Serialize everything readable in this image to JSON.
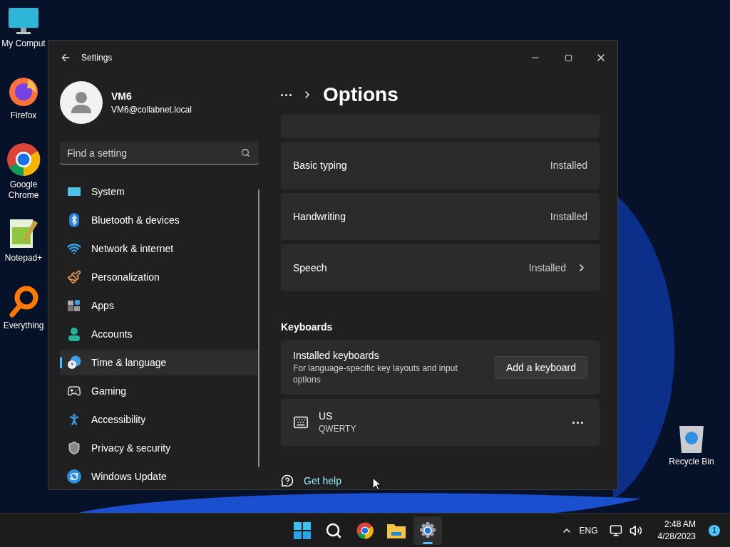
{
  "desktop": {
    "icons": [
      {
        "label": "My Comput",
        "kind": "computer"
      },
      {
        "label": "Firefox",
        "kind": "firefox"
      },
      {
        "label": "Google Chrome",
        "kind": "chrome"
      },
      {
        "label": "Notepad+",
        "kind": "notepad"
      },
      {
        "label": "Everything",
        "kind": "search"
      },
      {
        "label": "Recycle Bin",
        "kind": "recycle"
      }
    ]
  },
  "window": {
    "title": "Settings",
    "profile": {
      "name": "VM6",
      "email": "VM6@collabnet.local"
    },
    "search": {
      "placeholder": "Find a setting"
    },
    "nav": [
      {
        "label": "System",
        "kind": "system",
        "selected": false
      },
      {
        "label": "Bluetooth & devices",
        "kind": "bluetooth",
        "selected": false
      },
      {
        "label": "Network & internet",
        "kind": "network",
        "selected": false
      },
      {
        "label": "Personalization",
        "kind": "personalization",
        "selected": false
      },
      {
        "label": "Apps",
        "kind": "apps",
        "selected": false
      },
      {
        "label": "Accounts",
        "kind": "accounts",
        "selected": false
      },
      {
        "label": "Time & language",
        "kind": "time",
        "selected": true
      },
      {
        "label": "Gaming",
        "kind": "gaming",
        "selected": false
      },
      {
        "label": "Accessibility",
        "kind": "accessibility",
        "selected": false
      },
      {
        "label": "Privacy & security",
        "kind": "privacy",
        "selected": false
      },
      {
        "label": "Windows Update",
        "kind": "update",
        "selected": false
      }
    ],
    "page_title": "Options",
    "features": [
      {
        "label": "Basic typing",
        "status": "Installed",
        "expandable": false
      },
      {
        "label": "Handwriting",
        "status": "Installed",
        "expandable": false
      },
      {
        "label": "Speech",
        "status": "Installed",
        "expandable": true
      }
    ],
    "keyboards": {
      "heading": "Keyboards",
      "title": "Installed keyboards",
      "description": "For language-specific key layouts and input options",
      "button": "Add a keyboard",
      "layouts": [
        {
          "name": "US",
          "variant": "QWERTY"
        }
      ]
    },
    "help_link": "Get help"
  },
  "taskbar": {
    "apps": [
      {
        "kind": "start",
        "selected": false
      },
      {
        "kind": "search",
        "selected": false
      },
      {
        "kind": "chrome",
        "selected": false
      },
      {
        "kind": "explorer",
        "selected": false
      },
      {
        "kind": "settings",
        "selected": true
      }
    ],
    "language": "ENG",
    "time": "2:48 AM",
    "date": "4/28/2023",
    "notifications": "1"
  }
}
